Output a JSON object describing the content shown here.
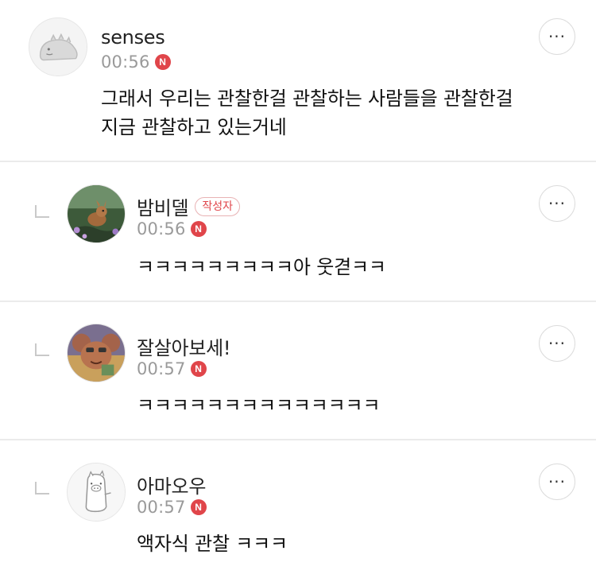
{
  "comments": [
    {
      "author": "senses",
      "badge": "",
      "time": "00:56",
      "new_badge": "N",
      "text_lines": [
        "그래서 우리는 관찰한걸 관찰하는 사람들을 관찰한걸",
        "지금 관찰하고 있는거네"
      ],
      "avatar": "dinosaur-avatar",
      "more_label": "···"
    },
    {
      "author": "밤비델",
      "badge": "작성자",
      "time": "00:56",
      "new_badge": "N",
      "text_lines": [
        "ㅋㅋㅋㅋㅋㅋㅋㅋㅋ아 웃겯ㅋㅋ"
      ],
      "avatar": "bambi-avatar",
      "more_label": "···"
    },
    {
      "author": "잘살아보세!",
      "badge": "",
      "time": "00:57",
      "new_badge": "N",
      "text_lines": [
        "ㅋㅋㅋㅋㅋㅋㅋㅋㅋㅋㅋㅋㅋㅋ"
      ],
      "avatar": "jerry-mouse-avatar",
      "more_label": "···"
    },
    {
      "author": "아마오우",
      "badge": "",
      "time": "00:57",
      "new_badge": "N",
      "text_lines": [
        "액자식 관찰 ㅋㅋㅋ"
      ],
      "avatar": "pig-character-avatar",
      "more_label": "···"
    }
  ],
  "colors": {
    "accent_red": "#e0454a",
    "divider": "#ebebeb",
    "time_gray": "#9a9a9a"
  }
}
